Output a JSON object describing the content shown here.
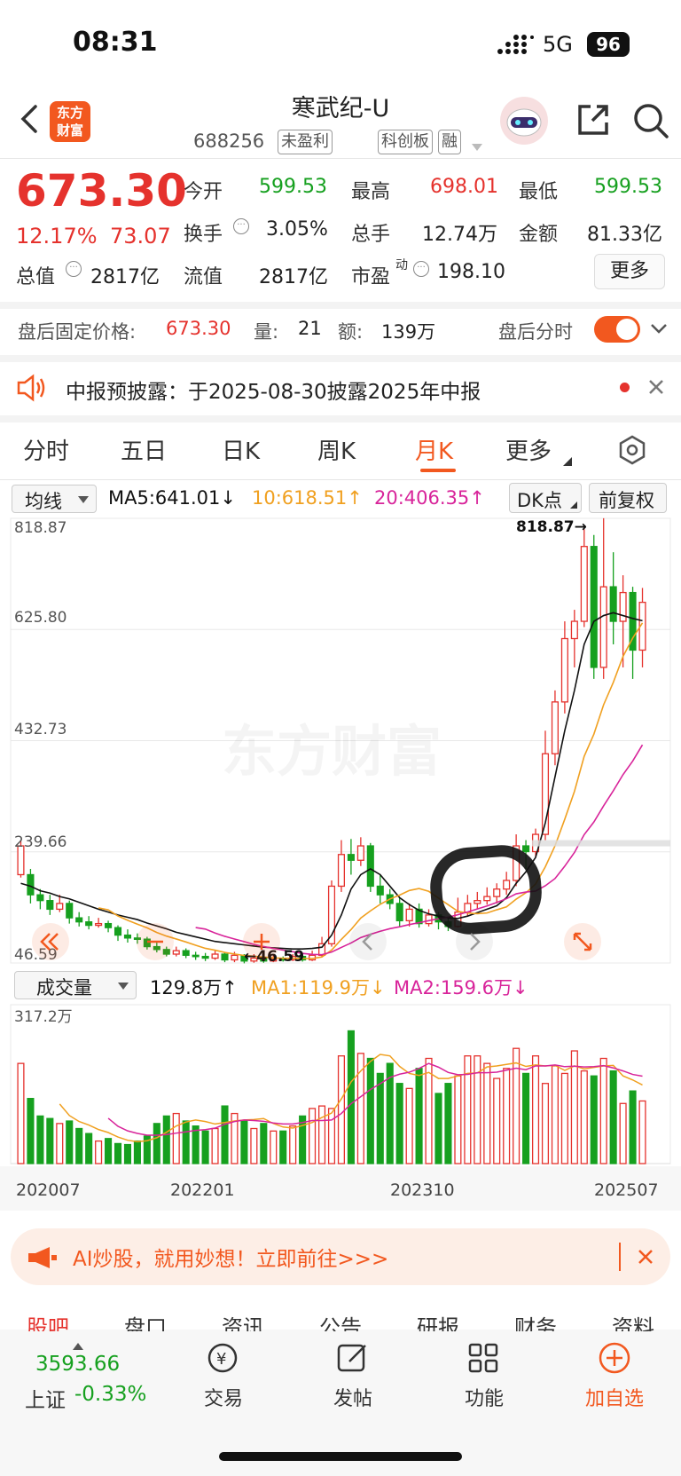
{
  "status_bar": {
    "time": "08:31",
    "network": "5G",
    "battery": "96"
  },
  "header": {
    "title": "寒武纪-U",
    "code": "688256",
    "tags": [
      "未盈利",
      "科创板",
      "融"
    ],
    "logo_text": "东方财富"
  },
  "quote": {
    "price": "673.30",
    "change_pct": "12.17%",
    "change_amt": "73.07",
    "fields": [
      {
        "label": "今开",
        "value": "599.53",
        "color": "#16a01f"
      },
      {
        "label": "最高",
        "value": "698.01",
        "color": "#e5322d"
      },
      {
        "label": "最低",
        "value": "599.53",
        "color": "#16a01f"
      },
      {
        "label": "换手",
        "value": "3.05%",
        "color": "#222222"
      },
      {
        "label": "总手",
        "value": "12.74万",
        "color": "#222222"
      },
      {
        "label": "金额",
        "value": "81.33亿",
        "color": "#222222"
      },
      {
        "label": "总值",
        "value": "2817亿",
        "color": "#222222"
      },
      {
        "label": "流值",
        "value": "2817亿",
        "color": "#222222"
      },
      {
        "label": "市盈",
        "value": "198.10",
        "color": "#222222",
        "sup": "动"
      }
    ],
    "more_label": "更多"
  },
  "after_hours": {
    "price_label": "盘后固定价格:",
    "price": "673.30",
    "volume_label": "量:",
    "volume": "21",
    "amount_label": "额:",
    "amount": "139万",
    "toggle_label": "盘后分时"
  },
  "notice": {
    "text": "中报预披露：于2025-08-30披露2025年中报"
  },
  "tabs": [
    "分时",
    "五日",
    "日K",
    "周K",
    "月K",
    "更多"
  ],
  "active_tab": "月K",
  "ma_legend": {
    "selector": "均线",
    "ma5": "MA5:641.01↓",
    "ma10": "10:618.51↑",
    "ma20": "20:406.35↑",
    "dk": "DK点",
    "fq": "前复权"
  },
  "price_axis": [
    "818.87",
    "625.80",
    "432.73",
    "239.66",
    "46.59"
  ],
  "high_marker": "818.87→",
  "low_marker": "←46.59",
  "watermark": "东方财富",
  "vol_legend": {
    "selector": "成交量",
    "vol": "129.8万↑",
    "ma1": "MA1:119.9万↓",
    "ma2": "MA2:159.6万↓"
  },
  "vol_axis": "317.2万",
  "date_labels": [
    "202007",
    "202201",
    "202310",
    "202507"
  ],
  "colors": {
    "up": "#e5322d",
    "down": "#16a01f",
    "accent": "#f2581f",
    "ma5": "#111111",
    "ma10": "#f0a020",
    "ma20": "#d8249a"
  },
  "chart_data": {
    "type": "candlestick",
    "price_range": [
      46.59,
      818.87
    ],
    "volume_range": [
      0,
      317.2
    ],
    "volume_unit": "万",
    "candles": [
      [
        250,
        200,
        260,
        195,
        1
      ],
      [
        200,
        165,
        210,
        150,
        0
      ],
      [
        165,
        155,
        175,
        140,
        0
      ],
      [
        155,
        140,
        165,
        130,
        0
      ],
      [
        140,
        150,
        165,
        135,
        1
      ],
      [
        150,
        125,
        155,
        115,
        0
      ],
      [
        125,
        118,
        135,
        110,
        0
      ],
      [
        118,
        112,
        128,
        105,
        0
      ],
      [
        112,
        115,
        125,
        108,
        1
      ],
      [
        115,
        108,
        120,
        100,
        0
      ],
      [
        108,
        95,
        112,
        85,
        0
      ],
      [
        95,
        90,
        105,
        82,
        0
      ],
      [
        90,
        88,
        98,
        80,
        0
      ],
      [
        88,
        75,
        92,
        70,
        0
      ],
      [
        75,
        70,
        82,
        65,
        0
      ],
      [
        70,
        62,
        75,
        58,
        0
      ],
      [
        62,
        68,
        75,
        58,
        1
      ],
      [
        68,
        60,
        72,
        55,
        0
      ],
      [
        60,
        58,
        66,
        52,
        0
      ],
      [
        58,
        55,
        64,
        50,
        0
      ],
      [
        55,
        62,
        68,
        52,
        1
      ],
      [
        62,
        52,
        65,
        48,
        0
      ],
      [
        52,
        60,
        66,
        48,
        1
      ],
      [
        60,
        50,
        62,
        46,
        0
      ],
      [
        50,
        55,
        62,
        47,
        1
      ],
      [
        55,
        50,
        60,
        47,
        0
      ],
      [
        50,
        54,
        60,
        48,
        1
      ],
      [
        54,
        52,
        58,
        49,
        0
      ],
      [
        52,
        58,
        62,
        50,
        1
      ],
      [
        58,
        52,
        60,
        49,
        0
      ],
      [
        52,
        60,
        68,
        50,
        1
      ],
      [
        60,
        80,
        92,
        58,
        1
      ],
      [
        80,
        180,
        190,
        75,
        1
      ],
      [
        180,
        235,
        260,
        170,
        1
      ],
      [
        235,
        225,
        262,
        200,
        0
      ],
      [
        225,
        250,
        265,
        215,
        1
      ],
      [
        250,
        180,
        255,
        170,
        0
      ],
      [
        180,
        165,
        200,
        150,
        0
      ],
      [
        165,
        150,
        175,
        140,
        0
      ],
      [
        150,
        120,
        160,
        110,
        0
      ],
      [
        120,
        140,
        150,
        110,
        1
      ],
      [
        140,
        115,
        150,
        108,
        0
      ],
      [
        115,
        130,
        140,
        110,
        1
      ],
      [
        130,
        118,
        135,
        105,
        0
      ],
      [
        118,
        110,
        124,
        102,
        0
      ],
      [
        110,
        135,
        160,
        108,
        1
      ],
      [
        135,
        150,
        165,
        128,
        1
      ],
      [
        150,
        155,
        170,
        140,
        1
      ],
      [
        155,
        162,
        178,
        148,
        1
      ],
      [
        162,
        175,
        185,
        150,
        1
      ],
      [
        175,
        190,
        205,
        165,
        1
      ],
      [
        190,
        250,
        270,
        180,
        1
      ],
      [
        250,
        240,
        260,
        210,
        0
      ],
      [
        240,
        270,
        280,
        230,
        1
      ],
      [
        270,
        410,
        450,
        260,
        1
      ],
      [
        410,
        500,
        520,
        390,
        1
      ],
      [
        500,
        610,
        640,
        480,
        1
      ],
      [
        610,
        640,
        660,
        560,
        1
      ],
      [
        640,
        770,
        800,
        630,
        1
      ],
      [
        770,
        560,
        790,
        540,
        0
      ],
      [
        560,
        700,
        819,
        540,
        1
      ],
      [
        700,
        640,
        760,
        600,
        0
      ],
      [
        640,
        690,
        720,
        560,
        1
      ],
      [
        690,
        590,
        700,
        540,
        0
      ],
      [
        590,
        673,
        698,
        560,
        1
      ]
    ],
    "volumes": [
      200,
      130,
      95,
      90,
      80,
      85,
      70,
      60,
      45,
      50,
      40,
      38,
      45,
      55,
      80,
      95,
      100,
      85,
      75,
      65,
      70,
      115,
      100,
      85,
      70,
      80,
      65,
      65,
      75,
      95,
      110,
      115,
      110,
      215,
      265,
      220,
      210,
      180,
      200,
      160,
      150,
      190,
      210,
      140,
      160,
      175,
      215,
      215,
      200,
      170,
      190,
      230,
      180,
      215,
      160,
      195,
      180,
      225,
      185,
      175,
      210,
      185,
      120,
      145,
      125
    ],
    "ma5": [
      185,
      180,
      172,
      168,
      162,
      158,
      152,
      146,
      140,
      135,
      130,
      126,
      122,
      116,
      111,
      106,
      100,
      96,
      92,
      88,
      84,
      82,
      80,
      78,
      76,
      74,
      73,
      72,
      71,
      71,
      72,
      74,
      95,
      130,
      175,
      200,
      210,
      200,
      180,
      160,
      148,
      138,
      132,
      128,
      125,
      124,
      128,
      134,
      140,
      146,
      160,
      185,
      205,
      230,
      290,
      370,
      450,
      520,
      600,
      640,
      650,
      655,
      650,
      645,
      641
    ]
  }
}
